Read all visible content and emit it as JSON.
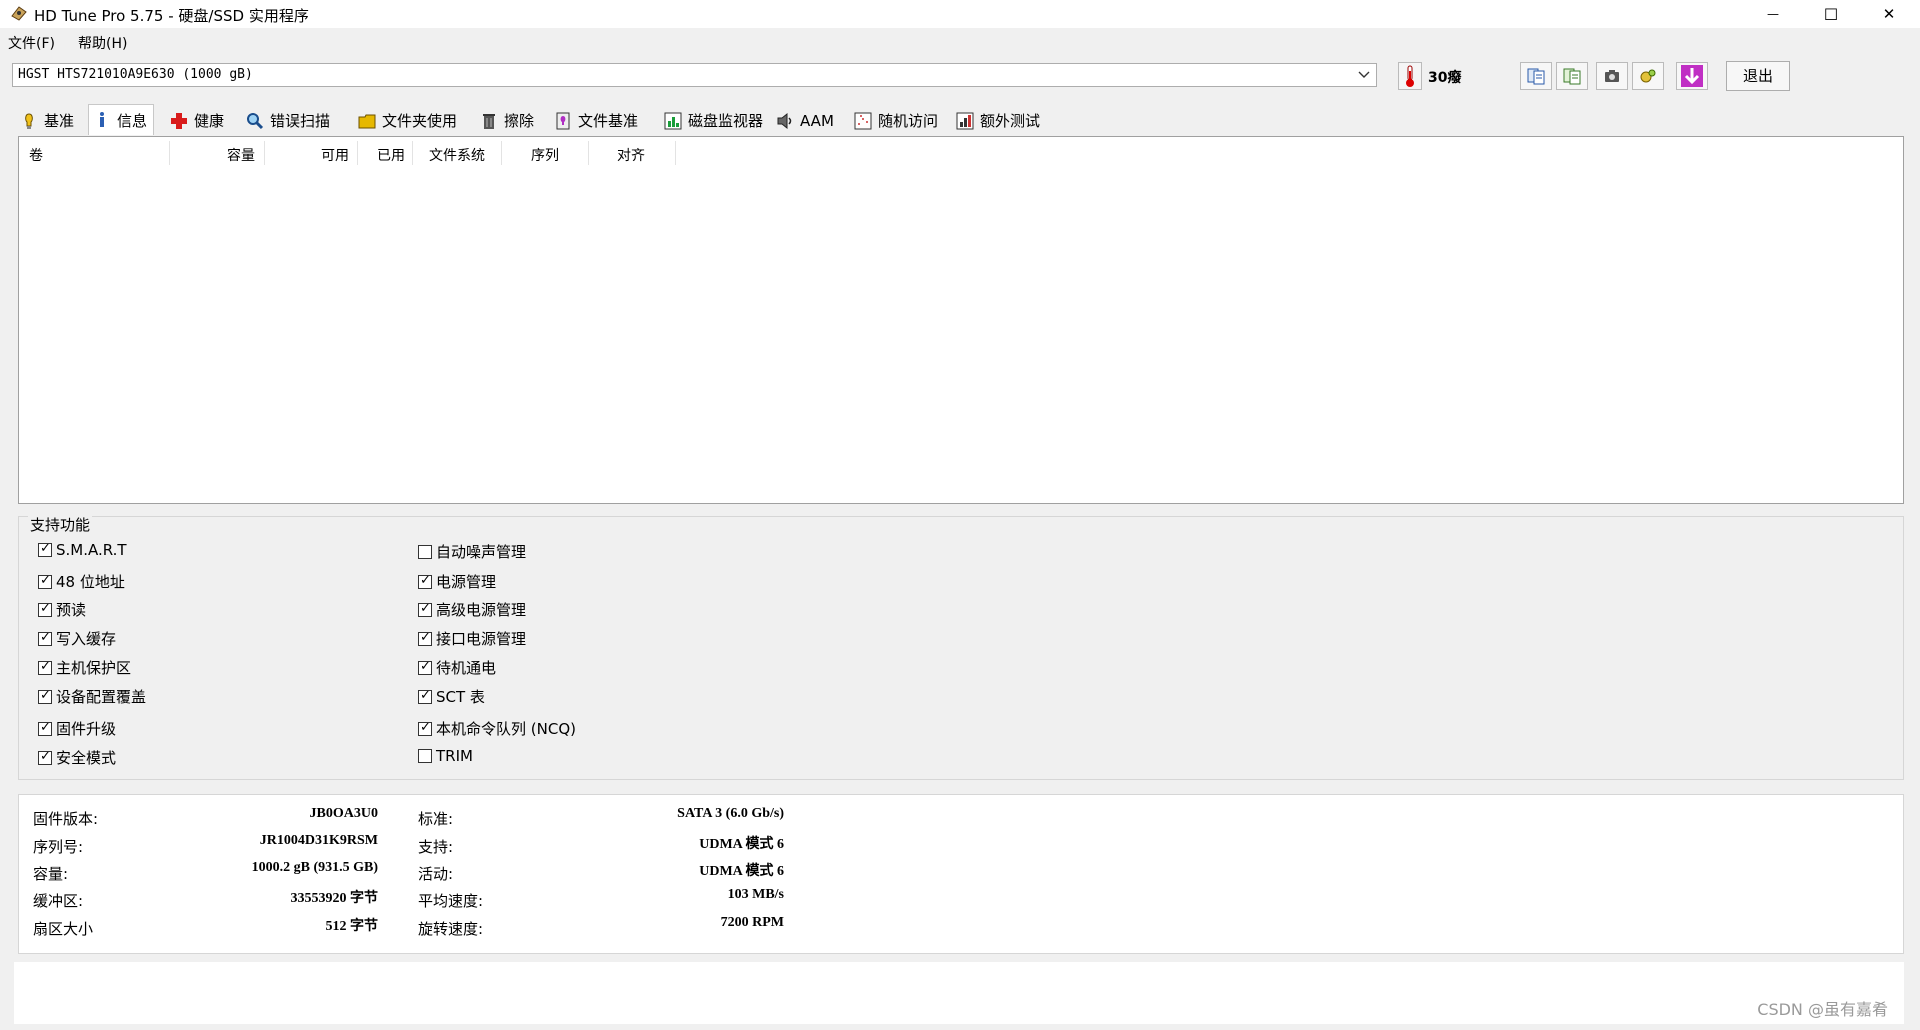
{
  "window": {
    "title": "HD Tune Pro 5.75 - 硬盘/SSD 实用程序",
    "minimize": "—",
    "maximize": "☐",
    "close": "✕"
  },
  "menu": {
    "file": "文件(F)",
    "help": "帮助(H)"
  },
  "toolbar": {
    "drive": "HGST HTS721010A9E630 (1000 gB)",
    "temperature": "30癈",
    "exit_label": "退出"
  },
  "tabs": [
    {
      "label": "基准",
      "icon": "benchmark-icon"
    },
    {
      "label": "信息",
      "icon": "info-icon"
    },
    {
      "label": "健康",
      "icon": "health-icon"
    },
    {
      "label": "错误扫描",
      "icon": "error-scan-icon"
    },
    {
      "label": "文件夹使用",
      "icon": "folder-icon"
    },
    {
      "label": "擦除",
      "icon": "erase-icon"
    },
    {
      "label": "文件基准",
      "icon": "file-benchmark-icon"
    },
    {
      "label": "磁盘监视器",
      "icon": "disk-monitor-icon"
    },
    {
      "label": "AAM",
      "icon": "aam-icon"
    },
    {
      "label": "随机访问",
      "icon": "random-access-icon"
    },
    {
      "label": "额外测试",
      "icon": "extra-tests-icon"
    }
  ],
  "active_tab": "信息",
  "volume_table": {
    "columns": [
      "卷",
      "容量",
      "可用",
      "已用",
      "文件系统",
      "序列",
      "对齐"
    ],
    "rows": []
  },
  "features": {
    "title": "支持功能",
    "left": [
      {
        "label": "S.M.A.R.T",
        "checked": true
      },
      {
        "label": "48 位地址",
        "checked": true
      },
      {
        "label": "预读",
        "checked": true
      },
      {
        "label": "写入缓存",
        "checked": true
      },
      {
        "label": "主机保护区",
        "checked": true
      },
      {
        "label": "设备配置覆盖",
        "checked": true
      },
      {
        "label": "固件升级",
        "checked": true
      },
      {
        "label": "安全模式",
        "checked": true
      }
    ],
    "right": [
      {
        "label": "自动噪声管理",
        "checked": false
      },
      {
        "label": "电源管理",
        "checked": true
      },
      {
        "label": "高级电源管理",
        "checked": true
      },
      {
        "label": "接口电源管理",
        "checked": true
      },
      {
        "label": "待机通电",
        "checked": true
      },
      {
        "label": "SCT 表",
        "checked": true
      },
      {
        "label": "本机命令队列 (NCQ)",
        "checked": true
      },
      {
        "label": "TRIM",
        "checked": false
      }
    ]
  },
  "info": {
    "left": [
      {
        "label": "固件版本:",
        "value": "JB0OA3U0"
      },
      {
        "label": "序列号:",
        "value": "JR1004D31K9RSM"
      },
      {
        "label": "容量:",
        "value": "1000.2 gB (931.5 GB)"
      },
      {
        "label": "缓冲区:",
        "value": "33553920 字节"
      },
      {
        "label": "扇区大小",
        "value": "512 字节"
      }
    ],
    "right": [
      {
        "label": "标准:",
        "value": "SATA 3 (6.0 Gb/s)"
      },
      {
        "label": "支持:",
        "value": "UDMA 模式 6"
      },
      {
        "label": "活动:",
        "value": "UDMA 模式 6"
      },
      {
        "label": "平均速度:",
        "value": "103 MB/s"
      },
      {
        "label": "旋转速度:",
        "value": "7200 RPM"
      }
    ]
  },
  "watermark": "CSDN @虽有嘉肴"
}
